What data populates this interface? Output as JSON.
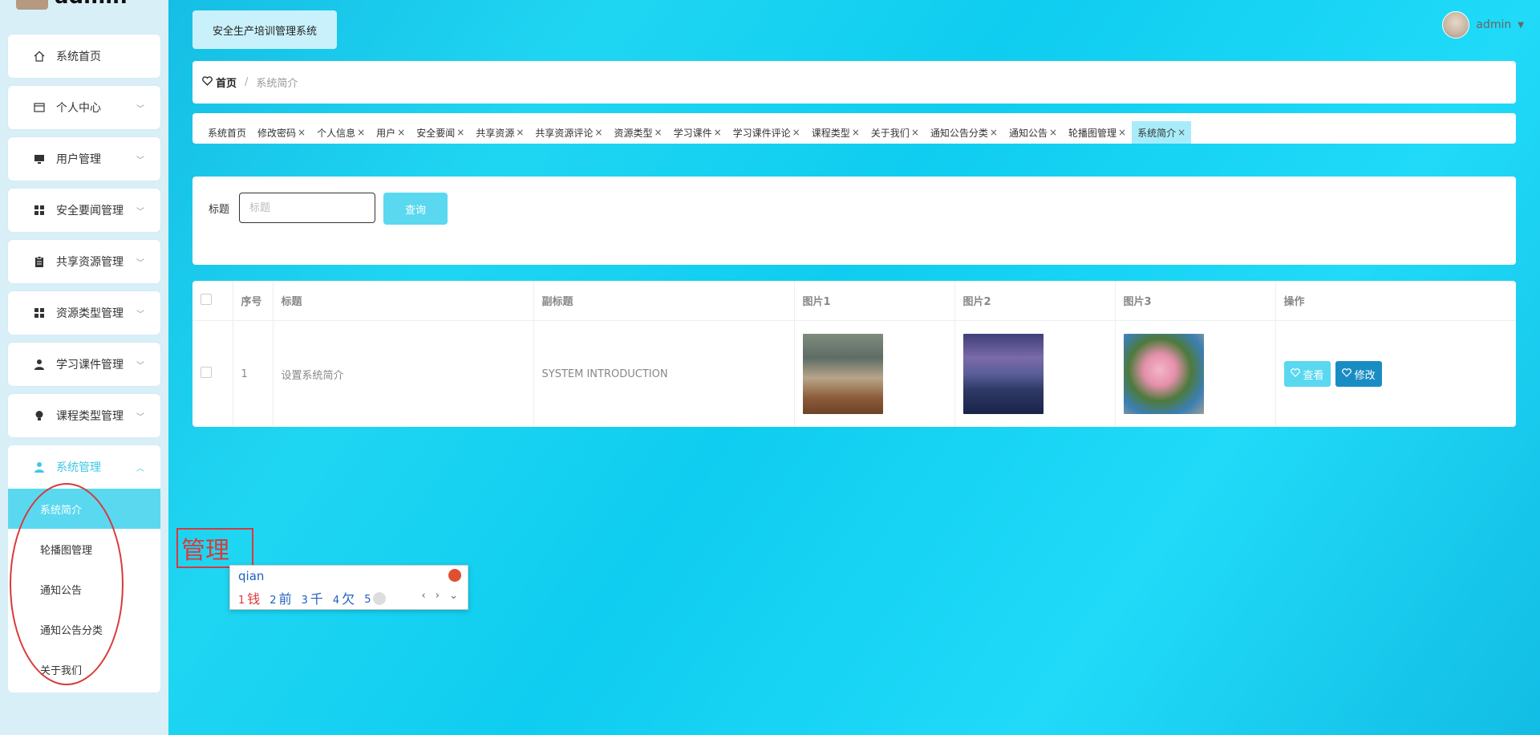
{
  "sidebar": {
    "username": "admin",
    "items": [
      {
        "label": "系统首页",
        "icon": "home-icon"
      },
      {
        "label": "个人中心",
        "icon": "card-icon"
      },
      {
        "label": "用户管理",
        "icon": "monitor-icon"
      },
      {
        "label": "安全要闻管理",
        "icon": "grid-icon"
      },
      {
        "label": "共享资源管理",
        "icon": "clipboard-icon"
      },
      {
        "label": "资源类型管理",
        "icon": "grid-icon"
      },
      {
        "label": "学习课件管理",
        "icon": "person-icon"
      },
      {
        "label": "课程类型管理",
        "icon": "bulb-icon"
      }
    ],
    "group": {
      "label": "系统管理",
      "icon": "user-icon",
      "subitems": [
        "系统简介",
        "轮播图管理",
        "通知公告",
        "通知公告分类",
        "关于我们"
      ]
    }
  },
  "header": {
    "system_title": "安全生产培训管理系统",
    "user": "admin"
  },
  "breadcrumb": {
    "home": "首页",
    "separator": "/",
    "current": "系统简介"
  },
  "tags": [
    {
      "label": "系统首页",
      "closable": false
    },
    {
      "label": "修改密码",
      "closable": true
    },
    {
      "label": "个人信息",
      "closable": true
    },
    {
      "label": "用户",
      "closable": true
    },
    {
      "label": "安全要闻",
      "closable": true
    },
    {
      "label": "共享资源",
      "closable": true
    },
    {
      "label": "共享资源评论",
      "closable": true
    },
    {
      "label": "资源类型",
      "closable": true
    },
    {
      "label": "学习课件",
      "closable": true
    },
    {
      "label": "学习课件评论",
      "closable": true
    },
    {
      "label": "课程类型",
      "closable": true
    },
    {
      "label": "关于我们",
      "closable": true
    },
    {
      "label": "通知公告分类",
      "closable": true
    },
    {
      "label": "通知公告",
      "closable": true
    },
    {
      "label": "轮播图管理",
      "closable": true
    },
    {
      "label": "系统简介",
      "closable": true,
      "active": true
    }
  ],
  "tag_close_symbol": "×",
  "search": {
    "label": "标题",
    "placeholder": "标题",
    "button": "查询"
  },
  "table": {
    "headers": [
      "序号",
      "标题",
      "副标题",
      "图片1",
      "图片2",
      "图片3",
      "操作"
    ],
    "rows": [
      {
        "index": "1",
        "title": "设置系统简介",
        "subtitle": "SYSTEM INTRODUCTION",
        "images": [
          "classroom",
          "pier",
          "flowers"
        ]
      }
    ],
    "view_label": "查看",
    "edit_label": "修改"
  },
  "ime": {
    "composing": "管理",
    "pinyin": "qian",
    "candidates": [
      {
        "n": "1",
        "text": "钱"
      },
      {
        "n": "2",
        "text": "前"
      },
      {
        "n": "3",
        "text": "千"
      },
      {
        "n": "4",
        "text": "欠"
      },
      {
        "n": "5",
        "text": ""
      }
    ],
    "nav": "‹ › ⌄"
  },
  "colors": {
    "accent": "#5ad8f0",
    "edit_button": "#1a8cc4",
    "annotation_red": "#d83a3a"
  }
}
